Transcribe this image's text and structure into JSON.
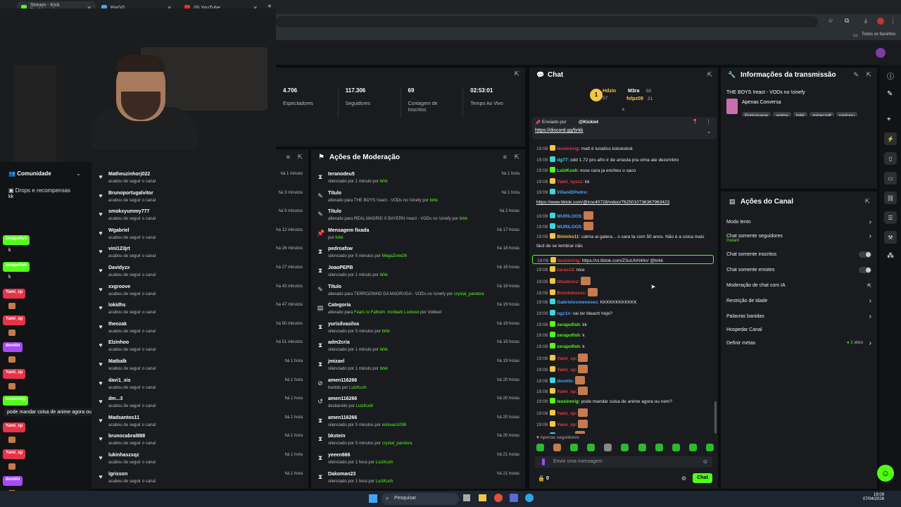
{
  "browser": {
    "tabs": [
      {
        "title": "Stream - Kick Dashboard",
        "color": "#53fc18"
      },
      {
        "title": "PixGG",
        "color": "#4aa3ff"
      },
      {
        "title": "(6) YouTube",
        "color": "#ff2a2a"
      }
    ],
    "bookmarks_label": "Todos os favoritos"
  },
  "stats": [
    {
      "value": "4.706",
      "label": "Espectadores"
    },
    {
      "value": "117.306",
      "label": "Seguidores"
    },
    {
      "value": "69",
      "label": "Contagem de Inscritos"
    },
    {
      "value": "02:53:01",
      "label": "Tempo Ao Vivo"
    }
  ],
  "sidebar": {
    "community": "Comunidade",
    "drops": "Drops e recompensas"
  },
  "overlay_chat": [
    {
      "name": "kk",
      "msg": "",
      "color": ""
    },
    {
      "name": "zerapofish",
      "msg": "k",
      "color": "#53fc18"
    },
    {
      "name": "zerapofish",
      "msg": "k",
      "color": "#53fc18"
    },
    {
      "name": "Yami_xp",
      "msg": "",
      "color": "#e5334a"
    },
    {
      "name": "Yami_xp",
      "msg": "",
      "color": "#e5334a"
    },
    {
      "name": "doretin",
      "msg": "",
      "color": "#a64bf5"
    },
    {
      "name": "Yami_xp",
      "msg": "",
      "color": "#e5334a"
    },
    {
      "name": "leozinnrig",
      "msg": "pode mandar coisa de anime agora ou nem?",
      "color": "#53fc18"
    },
    {
      "name": "Yami_xp",
      "msg": "",
      "color": "#e5334a"
    },
    {
      "name": "Yami_xp",
      "msg": "",
      "color": "#e5334a"
    },
    {
      "name": "doretin",
      "msg": "",
      "color": "#a64bf5"
    }
  ],
  "followers": {
    "rows": [
      {
        "name": "Matheuzinhorj022",
        "sub": "acabou de seguir o canal",
        "time": "há 1 minuto"
      },
      {
        "name": "Brunoportugalvitor",
        "sub": "acabou de seguir o canal",
        "time": "há 3 minutos"
      },
      {
        "name": "smokxyummy777",
        "sub": "acabou de seguir o canal",
        "time": "há 9 minutos"
      },
      {
        "name": "Wgabriel",
        "sub": "acabou de seguir o canal",
        "time": "há 12 minutos"
      },
      {
        "name": "vini123jrt",
        "sub": "acabou de seguir o canal",
        "time": "há 26 minutos"
      },
      {
        "name": "Davidyzx",
        "sub": "acabou de seguir o canal",
        "time": "há 27 minutos"
      },
      {
        "name": "xxgroove",
        "sub": "acabou de seguir o canal",
        "time": "há 43 minutos"
      },
      {
        "name": "lokidhs",
        "sub": "acabou de seguir o canal",
        "time": "há 47 minutos"
      },
      {
        "name": "theozak",
        "sub": "acabou de seguir o canal",
        "time": "há 50 minutos"
      },
      {
        "name": "Elzinhoo",
        "sub": "acabou de seguir o canal",
        "time": "há 51 minutos"
      },
      {
        "name": "Matbalk",
        "sub": "acabou de seguir o canal",
        "time": "há 1 hora"
      },
      {
        "name": "davi1_xis",
        "sub": "acabou de seguir o canal",
        "time": "há 1 hora"
      },
      {
        "name": "dm...3",
        "sub": "acabou de seguir o canal",
        "time": "há 1 hora"
      },
      {
        "name": "Madsantos11",
        "sub": "acabou de seguir o canal",
        "time": "há 1 hora"
      },
      {
        "name": "brunocabral888",
        "sub": "acabou de seguir o canal",
        "time": "há 1 hora"
      },
      {
        "name": "lukinhaszxqz",
        "sub": "acabou de seguir o canal",
        "time": "há 1 hora"
      },
      {
        "name": "lgrisson",
        "sub": "acabou de seguir o canal",
        "time": "há 1 hora"
      }
    ]
  },
  "moderation": {
    "title": "Ações de Moderação",
    "rows": [
      {
        "icon": "⧗",
        "name": "teranodeu5",
        "pre": "silenciado por 1 minuto por ",
        "hl": "brkk",
        "post": "",
        "time": "há 1 hora"
      },
      {
        "icon": "✎",
        "name": "Título",
        "pre": "alterado para THE BOYS !react - VODs no !cinefy por ",
        "hl": "brkk",
        "post": "",
        "time": "há 1 hora"
      },
      {
        "icon": "✎",
        "name": "Título",
        "pre": "alterado para REAL MADRID X BAYERN !react - VODs no !cinefy por ",
        "hl": "brkk",
        "post": "",
        "time": "há 2 horas"
      },
      {
        "icon": "📌",
        "name": "Mensagem fixada",
        "pre": "por ",
        "hl": "brkk",
        "post": "",
        "time": "há 17 horas"
      },
      {
        "icon": "⧗",
        "name": "pedroafsw",
        "pre": "silenciado por 5 minutos por ",
        "hl": "MegaZone26",
        "post": "",
        "time": "há 18 horas"
      },
      {
        "icon": "⧗",
        "name": "JoaoPEPB",
        "pre": "silenciado por 1 minuto por ",
        "hl": "brkk",
        "post": "",
        "time": "há 18 horas"
      },
      {
        "icon": "✎",
        "name": "Título",
        "pre": "alterado para TERROZINHO DA MADRUGA - VODs no !cinefy por ",
        "hl": "crystal_pandora",
        "post": "",
        "time": "há 18 horas"
      },
      {
        "icon": "▤",
        "name": "Categoria",
        "pre": "alterado para ",
        "hl": "Fears to Fathom: Ironbark Lookout",
        "post": " por Volbeel",
        "time": "há 19 horas"
      },
      {
        "icon": "⧗",
        "name": "yurisilvasilva",
        "pre": "silenciado por 5 minutos por ",
        "hl": "brkk",
        "post": "",
        "time": "há 19 horas"
      },
      {
        "icon": "⧗",
        "name": "adm2cria",
        "pre": "silenciado por 1 minuto por ",
        "hl": "brkk",
        "post": "",
        "time": "há 19 horas"
      },
      {
        "icon": "⧗",
        "name": "jmizael",
        "pre": "silenciado por 1 minuto por ",
        "hl": "brkk",
        "post": "",
        "time": "há 19 horas"
      },
      {
        "icon": "⊘",
        "name": "amen116266",
        "pre": "banido por ",
        "hl": "LuizKush",
        "post": "",
        "time": "há 20 horas"
      },
      {
        "icon": "↺",
        "name": "amen116266",
        "pre": "desbanido por ",
        "hl": "LuizKush",
        "post": "",
        "time": "há 20 horas"
      },
      {
        "icon": "⧗",
        "name": "amen116266",
        "pre": "silenciado por 5 minutos por ",
        "hl": "estevao1098",
        "post": "",
        "time": "há 20 horas"
      },
      {
        "icon": "⧗",
        "name": "bkstein",
        "pre": "silenciado por 5 minutos por ",
        "hl": "crystal_pandora",
        "post": "",
        "time": "há 20 horas"
      },
      {
        "icon": "⧗",
        "name": "yeeen666",
        "pre": "silenciado por 1 hora por ",
        "hl": "LuizKush",
        "post": "",
        "time": "há 21 horas"
      },
      {
        "icon": "⧗",
        "name": "Dakoman23",
        "pre": "silenciado por 1 hora por ",
        "hl": "LuizKush",
        "post": "",
        "time": "há 21 horas"
      }
    ]
  },
  "chat": {
    "title": "Chat",
    "top": [
      {
        "name": "Hdzin",
        "count": "57"
      },
      {
        "name": "M3ra",
        "count": "50"
      },
      {
        "name": "felpz09",
        "count": "21"
      }
    ],
    "pinned": {
      "by_label": "Enviado por",
      "user": "@Kickiot",
      "link": "https://discord.gg/brkk"
    },
    "messages": [
      {
        "time": "19:08",
        "user": "leozinnrig",
        "ucls": "uname-r",
        "text": ": matt é lunatico ksksksksk",
        "emote": false
      },
      {
        "time": "19:08",
        "user": "dg77",
        "ucls": "uname-c",
        "text": ": odd 1.72 pro afro ir de arrasta pra cima ate dezembro",
        "emote": false
      },
      {
        "time": "19:08",
        "user": "LuizKush",
        "ucls": "uname-g",
        "text": ": esse cara ja encheu o saco",
        "emote": false
      },
      {
        "time": "19:08",
        "user": "Yami_xpzzz",
        "ucls": "uname-r",
        "text": ": kk",
        "emote": false
      },
      {
        "time": "19:08",
        "user": "VillaniDPedro",
        "ucls": "uname-b",
        "text": ":",
        "emote": false
      },
      {
        "time": "",
        "user": "",
        "ucls": "",
        "text": "https://www.tiktok.com/@iroc40728/video/7625010736367963423",
        "emote": false
      },
      {
        "time": "19:08",
        "user": "MURILOO5",
        "ucls": "uname-b",
        "text": ":",
        "emote": true
      },
      {
        "time": "19:08",
        "user": "MURILOO5",
        "ucls": "uname-b",
        "text": ":",
        "emote": true
      },
      {
        "time": "19:08",
        "user": "Bininho11",
        "ucls": "uname-y",
        "text": ": calma ai galera... o cara ta com 50 anos. Não é a coisa mais",
        "emote": false
      },
      {
        "time": "",
        "user": "",
        "ucls": "",
        "text": "fácil de se lembrar não",
        "emote": false
      },
      {
        "time": "19:08",
        "user": "leozinnrig",
        "ucls": "uname-r",
        "text": ": https://vt.tiktok.com/ZSuUhH4hn/ @brkk",
        "emote": false
      },
      {
        "time": "19:08",
        "user": "lucas12",
        "ucls": "uname-r",
        "text": ": nice",
        "emote": false
      },
      {
        "time": "19:08",
        "user": "tiltadoxxz",
        "ucls": "uname-r",
        "text": ":",
        "emote": true
      },
      {
        "time": "19:08",
        "user": "Bruninhoxxx",
        "ucls": "uname-r",
        "text": ":",
        "emote": true
      },
      {
        "time": "19:08",
        "user": "Gabrielosmeneses",
        "ucls": "uname-b",
        "text": ": KKKKKKKKKKKK",
        "emote": false
      },
      {
        "time": "19:08",
        "user": "ngz1n",
        "ucls": "uname-b",
        "text": ": vai ter bleach hoje?",
        "emote": false
      },
      {
        "time": "19:08",
        "user": "zerapofish",
        "ucls": "uname-g",
        "text": ": kk",
        "emote": false
      },
      {
        "time": "19:08",
        "user": "zerapofish",
        "ucls": "uname-g",
        "text": ": k",
        "emote": false
      },
      {
        "time": "19:08",
        "user": "zerapofish",
        "ucls": "uname-g",
        "text": ": k",
        "emote": false
      },
      {
        "time": "19:08",
        "user": "Yami_xp",
        "ucls": "uname-r",
        "text": ":",
        "emote": true
      },
      {
        "time": "19:08",
        "user": "Yami_xp",
        "ucls": "uname-r",
        "text": ":",
        "emote": true
      },
      {
        "time": "19:08",
        "user": "doretin",
        "ucls": "uname-b",
        "text": ":",
        "emote": true
      },
      {
        "time": "19:08",
        "user": "Yami_xp",
        "ucls": "uname-r",
        "text": ":",
        "emote": true
      },
      {
        "time": "19:08",
        "user": "leozinnrig",
        "ucls": "uname-g",
        "text": ": pode mandar coisa de anime agora ou nem?",
        "emote": false
      },
      {
        "time": "19:08",
        "user": "Yami_xp",
        "ucls": "uname-r",
        "text": ":",
        "emote": true
      },
      {
        "time": "19:08",
        "user": "Yami_xp",
        "ucls": "uname-r",
        "text": ":",
        "emote": true
      },
      {
        "time": "19:08",
        "user": "doretin",
        "ucls": "uname-b",
        "text": ":",
        "emote": true
      }
    ],
    "followers_only": "Apenas seguidores",
    "input_placeholder": "Envie uma mensagem",
    "count": "0",
    "send": "Chat"
  },
  "stream_info": {
    "title": "Informações da transmissão",
    "stream_title": "THE BOYS !react - VODs no !cinefy",
    "category": "Apenas Conversa",
    "tags": [
      "Portuguese",
      "anime",
      "brkk",
      "minecraft",
      "portugu"
    ]
  },
  "channel_actions": {
    "title": "Ações do Canal",
    "items": [
      {
        "label": "Modo lento",
        "sub": "",
        "right": "chevron"
      },
      {
        "label": "Chat somente seguidores",
        "sub": "Instant",
        "right": "chevron"
      },
      {
        "label": "Chat somente inscritos",
        "sub": "",
        "right": "toggle"
      },
      {
        "label": "Chat somente emotes",
        "sub": "",
        "right": "toggle"
      },
      {
        "label": "Moderação de chat com IA",
        "sub": "",
        "right": "external"
      },
      {
        "label": "Restrição de idade",
        "sub": "",
        "right": "chevron"
      },
      {
        "label": "Palavras banidas",
        "sub": "",
        "right": "chevron"
      },
      {
        "label": "Hospedar Canal",
        "sub": "",
        "right": ""
      },
      {
        "label": "Definir metas",
        "sub": "",
        "right": "goals",
        "extra": "2 ativo"
      }
    ]
  },
  "taskbar": {
    "search": "Pesquisar",
    "time": "19:09",
    "date": "07/04/2026"
  }
}
